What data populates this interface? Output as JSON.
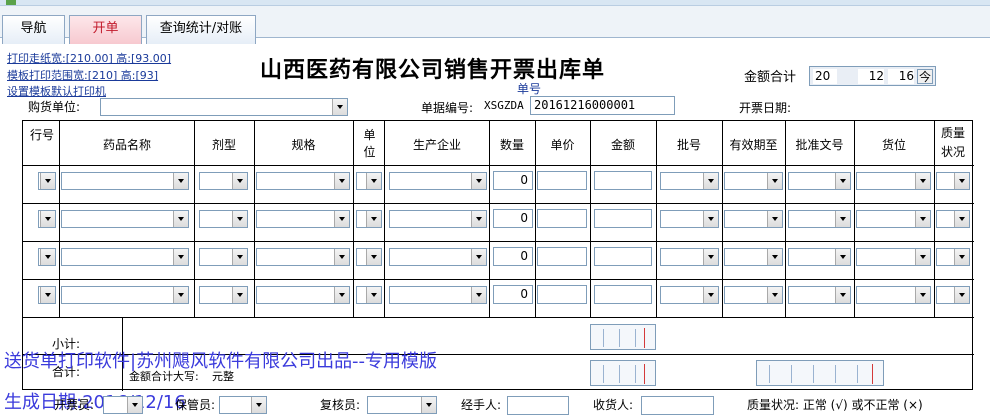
{
  "tabs": [
    "导航",
    "开单",
    "查询统计/对账"
  ],
  "print_links": [
    "打印走纸宽:[210.00] 高:[93.00]",
    "模板打印范围宽:[210] 高:[93]",
    "设置模板默认打印机"
  ],
  "title": "山西医药有限公司销售开票出库单",
  "amount_total_label": "金额合计",
  "datetime_parts": [
    "20",
    "12",
    "16",
    "今"
  ],
  "danhao_label": "单号",
  "buyer_label": "购货单位:",
  "bill_no_label": "单据编号:",
  "bill_no_prefix": "XSGZDA",
  "bill_no_value": "20161216000001",
  "invoice_date_label": "开票日期:",
  "columns": [
    "行号",
    "药品名称",
    "剂型",
    "规格",
    "单位",
    "生产企业",
    "数量",
    "单价",
    "金额",
    "批号",
    "有效期至",
    "批准文号",
    "货位",
    "质量状况"
  ],
  "row_qty": [
    "0",
    "0",
    "0",
    "0"
  ],
  "subtotal_label": "小计:",
  "total_label": "合计:",
  "amount_caps_label": "金额合计大写:",
  "amount_caps_value": "元整",
  "watermark_lines": [
    "送货单打印软件|苏州飓风软件有限公司出品--专用模版",
    "生成日期:2016/12/16"
  ],
  "footer": {
    "seller_label": "开票员:",
    "keeper_label": "保管员:",
    "checker_label": "复核员:",
    "handler_label": "经手人:",
    "receiver_label": "收货人:",
    "quality_text": "质量状况: 正常 (√) 或不正常 (×)"
  }
}
